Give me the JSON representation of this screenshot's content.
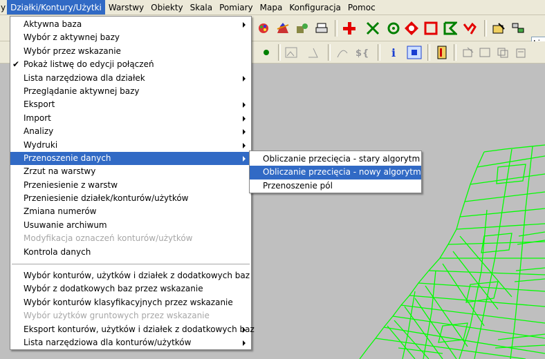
{
  "menubar": {
    "items": [
      {
        "key": "cut",
        "label": "y"
      },
      {
        "key": "dzialki",
        "label": "Działki/Kontury/Użytki"
      },
      {
        "key": "warstwy",
        "label": "Warstwy"
      },
      {
        "key": "obiekty",
        "label": "Obiekty"
      },
      {
        "key": "skala",
        "label": "Skala"
      },
      {
        "key": "pomiary",
        "label": "Pomiary"
      },
      {
        "key": "mapa",
        "label": "Mapa"
      },
      {
        "key": "konfiguracja",
        "label": "Konfiguracja"
      },
      {
        "key": "pomoc",
        "label": "Pomoc"
      }
    ]
  },
  "toolbar": {
    "list_field_value": "List",
    "info_glyph": "i",
    "colors": {
      "red": "#e30000",
      "green": "#008000",
      "blue": "#1a3fd1"
    }
  },
  "main_menu": {
    "items": [
      {
        "label": "Aktywna baza",
        "submenu": true
      },
      {
        "label": "Wybór z aktywnej bazy"
      },
      {
        "label": "Wybór przez wskazanie"
      },
      {
        "label": "Pokaż listwę do edycji połączeń",
        "checked": true
      },
      {
        "label": "Lista narzędziowa dla działek",
        "submenu": true
      },
      {
        "label": "Przeglądanie aktywnej bazy"
      },
      {
        "label": "Eksport",
        "submenu": true
      },
      {
        "label": "Import",
        "submenu": true
      },
      {
        "label": "Analizy",
        "submenu": true
      },
      {
        "label": "Wydruki",
        "submenu": true
      },
      {
        "label": "Przenoszenie danych",
        "submenu": true,
        "selected": true
      },
      {
        "label": "Zrzut na warstwy"
      },
      {
        "label": "Przeniesienie z warstw"
      },
      {
        "label": "Przeniesienie działek/konturów/użytków"
      },
      {
        "label": "Zmiana numerów"
      },
      {
        "label": "Usuwanie archiwum"
      },
      {
        "label": "Modyfikacja oznaczeń konturów/użytków",
        "disabled": true
      },
      {
        "label": "Kontrola danych"
      },
      {
        "label": "Wybór konturów, użytków i działek z dodatkowych baz"
      },
      {
        "label": "Wybór z dodatkowych baz przez wskazanie"
      },
      {
        "label": "Wybór konturów klasyfikacyjnych przez wskazanie"
      },
      {
        "label": "Wybór użytków gruntowych przez wskazanie",
        "disabled": true
      },
      {
        "label": "Eksport konturów, użytków i działek z dodatkowych baz",
        "submenu": true
      },
      {
        "label": "Lista narzędziowa dla konturów/użytków",
        "submenu": true
      }
    ]
  },
  "sub_menu": {
    "items": [
      {
        "label": "Obliczanie przecięcia - stary algorytm"
      },
      {
        "label": "Obliczanie przecięcia - nowy algorytm",
        "selected": true
      },
      {
        "label": "Przenoszenie pól"
      }
    ]
  },
  "map": {
    "line_color": "#00ff00",
    "background": "#bfbfbf"
  }
}
